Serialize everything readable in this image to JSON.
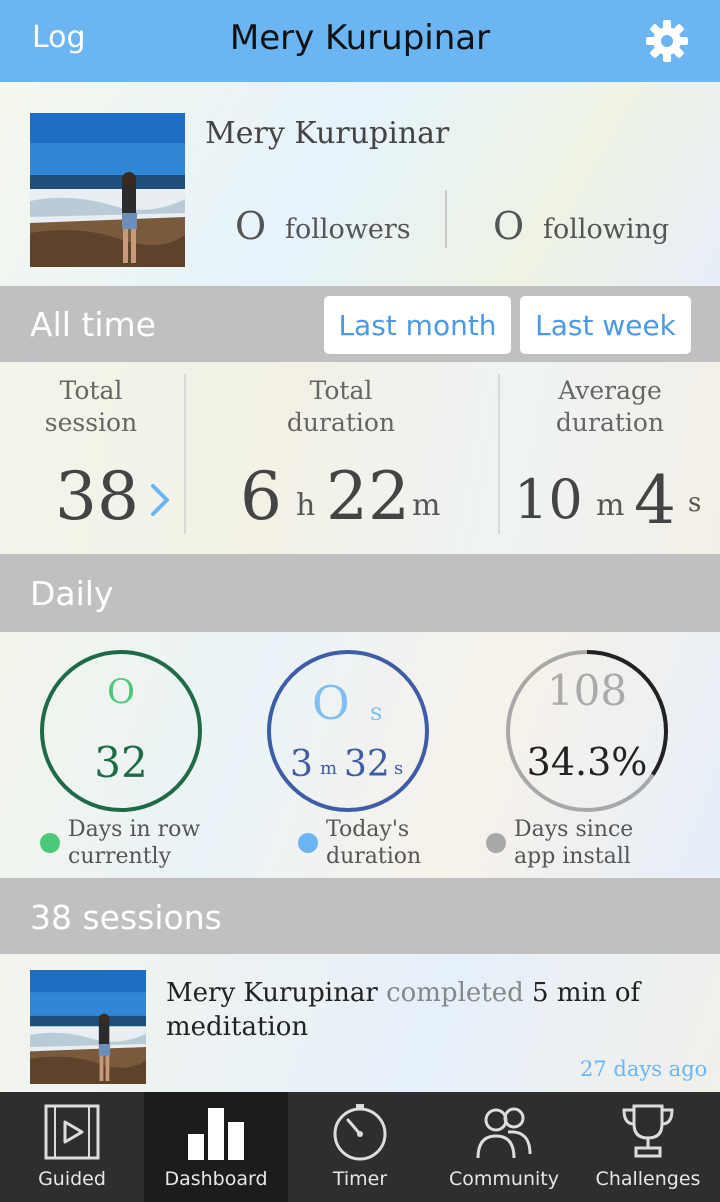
{
  "header": {
    "left_label": "Log",
    "title": "Mery Kurupinar",
    "settings_icon": "gear-icon",
    "background_color": "#6ab5f2"
  },
  "profile": {
    "name": "Mery Kurupinar",
    "followers_count": "O",
    "followers_label": "followers",
    "following_count": "O",
    "following_label": "following"
  },
  "period": {
    "title": "All time",
    "filters": [
      "Last month",
      "Last week"
    ]
  },
  "stats": {
    "total_session_label_1": "Total",
    "total_session_label_2": "session",
    "total_session_value": "38",
    "total_duration_label_1": "Total",
    "total_duration_label_2": "duration",
    "total_duration_hours": "6",
    "total_duration_hours_unit": "h",
    "total_duration_minutes": "22",
    "total_duration_minutes_unit": "m",
    "average_duration_label_1": "Average",
    "average_duration_label_2": "duration",
    "average_duration_minutes": "10",
    "average_duration_minutes_unit": "m",
    "average_duration_seconds": "4",
    "average_duration_seconds_unit": "s"
  },
  "daily": {
    "title": "Daily",
    "days_in_row": {
      "top": "O",
      "main": "32",
      "label_1": "Days in row",
      "label_2": "currently",
      "color": "#1f6b47",
      "dot_color": "#4cc87a"
    },
    "todays_duration": {
      "top_value": "O",
      "top_unit": "s",
      "minutes": "3",
      "minutes_unit": "m",
      "seconds": "32",
      "seconds_unit": "s",
      "label_1": "Today's",
      "label_2": "duration",
      "color": "#3f5da6",
      "dot_color": "#6ab5f2"
    },
    "days_since_install": {
      "top": "108",
      "main": "34.3%",
      "progress_percent": 34.3,
      "label_1": "Days since",
      "label_2": "app install",
      "color": "#9a9a9a",
      "dot_color": "#a8a8a8"
    }
  },
  "sessions": {
    "title": "38 sessions",
    "feed": [
      {
        "user": "Mery Kurupinar",
        "action": "completed",
        "duration": "5 min",
        "text_end": "of meditation",
        "time_ago": "27 days ago"
      }
    ]
  },
  "tabbar": {
    "tabs": [
      {
        "label": "Guided",
        "icon": "video-icon"
      },
      {
        "label": "Dashboard",
        "icon": "bar-chart-icon"
      },
      {
        "label": "Timer",
        "icon": "timer-icon"
      },
      {
        "label": "Community",
        "icon": "people-icon"
      },
      {
        "label": "Challenges",
        "icon": "trophy-icon"
      }
    ],
    "active_tab": "Dashboard"
  }
}
